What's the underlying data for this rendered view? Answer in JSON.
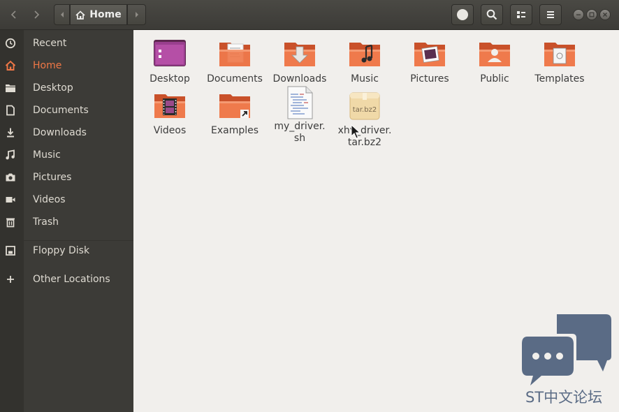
{
  "header": {
    "back_icon": "chevron-left-icon",
    "forward_icon": "chevron-right-icon",
    "path_prev_icon": "triangle-left-icon",
    "path_next_icon": "triangle-right-icon",
    "current_location": "Home",
    "buttons": [
      "record-icon",
      "search-icon",
      "view-list-icon",
      "menu-icon"
    ]
  },
  "sidebar": {
    "items": [
      {
        "label": "Recent",
        "icon": "clock-icon"
      },
      {
        "label": "Home",
        "icon": "home-icon",
        "active": true
      },
      {
        "label": "Desktop",
        "icon": "folder-icon"
      },
      {
        "label": "Documents",
        "icon": "document-icon"
      },
      {
        "label": "Downloads",
        "icon": "download-icon"
      },
      {
        "label": "Music",
        "icon": "music-icon"
      },
      {
        "label": "Pictures",
        "icon": "camera-icon"
      },
      {
        "label": "Videos",
        "icon": "video-icon"
      },
      {
        "label": "Trash",
        "icon": "trash-icon"
      },
      {
        "label": "Floppy Disk",
        "icon": "floppy-icon"
      },
      {
        "label": "Other Locations",
        "icon": "plus-icon"
      }
    ]
  },
  "files": [
    {
      "name": "Desktop",
      "type": "folder-desktop"
    },
    {
      "name": "Documents",
      "type": "folder-documents"
    },
    {
      "name": "Downloads",
      "type": "folder-downloads"
    },
    {
      "name": "Music",
      "type": "folder-music"
    },
    {
      "name": "Pictures",
      "type": "folder-pictures"
    },
    {
      "name": "Public",
      "type": "folder-public"
    },
    {
      "name": "Templates",
      "type": "folder-templates"
    },
    {
      "name": "Videos",
      "type": "folder-videos"
    },
    {
      "name": "Examples",
      "type": "folder-link"
    },
    {
      "name_line1": "my_driver.",
      "name_line2": "sh",
      "type": "shell-script"
    },
    {
      "name_line1": "xhv_driver.",
      "name_line2": "tar.bz2",
      "type": "archive",
      "icon_text": "tar.bz2"
    }
  ],
  "colors": {
    "accent": "#f07746",
    "sidebar_bg": "#3c3b37",
    "header_bg": "#3c3b37",
    "content_bg": "#f1efec",
    "folder_orange": "#e2653a",
    "watermark": "#5a6b85"
  },
  "watermark": {
    "text": "ST中文论坛",
    "icon": "chat-bubbles-icon"
  }
}
